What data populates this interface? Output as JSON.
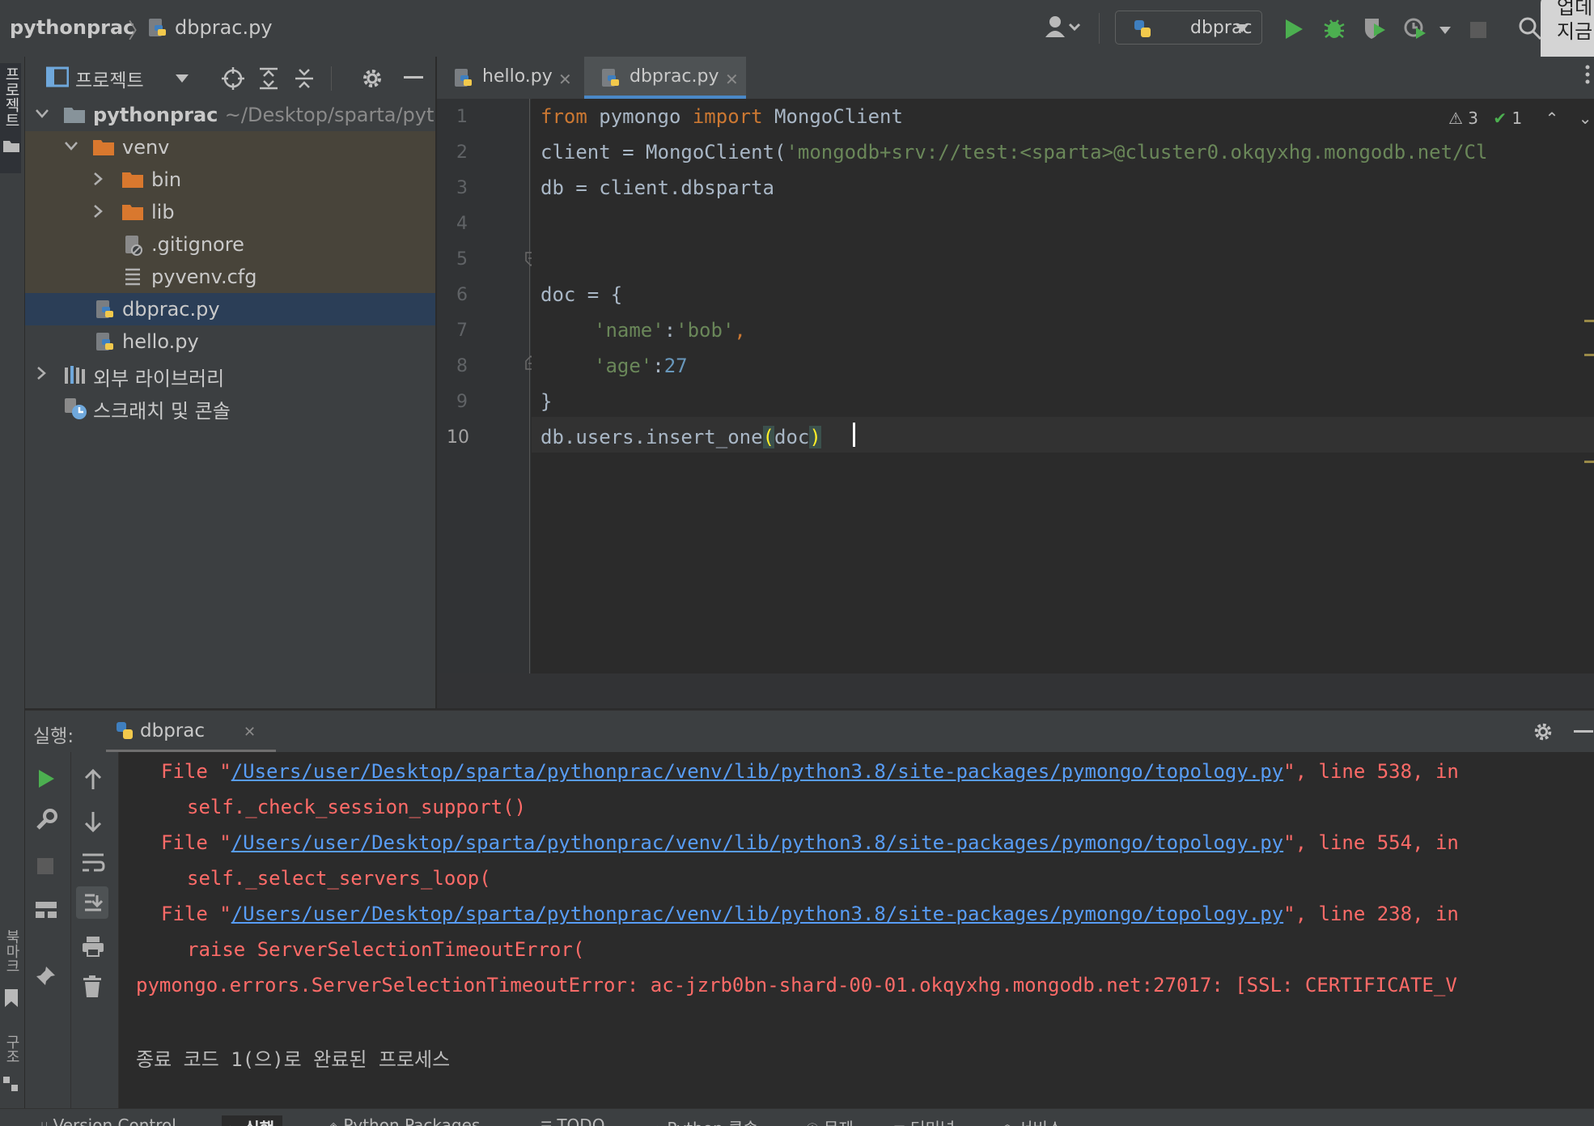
{
  "navbar": {
    "project": "pythonprac",
    "file": "dbprac.py",
    "run_config": "dbprac",
    "notification": [
      "업데",
      "지금"
    ]
  },
  "left_stripe": {
    "project": "프로젝트",
    "bookmarks": "북마크",
    "structure": "구조"
  },
  "project_panel": {
    "title": "프로젝트",
    "tree": {
      "root_name": "pythonprac",
      "root_path": "~/Desktop/sparta/pyth",
      "venv": "venv",
      "bin": "bin",
      "lib": "lib",
      "gitignore": ".gitignore",
      "pyvenv": "pyvenv.cfg",
      "dbprac": "dbprac.py",
      "hello": "hello.py",
      "ext_libs": "외부 라이브러리",
      "scratches": "스크래치 및 콘솔"
    }
  },
  "editor": {
    "tabs": [
      "hello.py",
      "dbprac.py"
    ],
    "active_tab": "dbprac.py",
    "line_numbers": [
      "1",
      "2",
      "3",
      "4",
      "5",
      "6",
      "7",
      "8",
      "9",
      "10"
    ],
    "code": {
      "l1_from": "from",
      "l1_mod": " pymongo ",
      "l1_import": "import",
      "l1_name": " MongoClient",
      "l2_a": "client = MongoClient(",
      "l2_str": "'mongodb+srv://test:<sparta>@cluster0.okqyxhg.mongodb.net/Cl",
      "l3": "db = client.dbsparta",
      "l5": "doc = {",
      "l6_key": "'name'",
      "l6_colon": ":",
      "l6_val": "'bob'",
      "l6_comma": ",",
      "l7_key": "'age'",
      "l7_colon": ":",
      "l7_val": "27",
      "l8": "}",
      "l10_a": "db.users.insert_one",
      "l10_open": "(",
      "l10_arg": "doc",
      "l10_close": ")"
    },
    "inspections": {
      "warnings": "3",
      "ok": "1"
    }
  },
  "run_panel": {
    "label": "실행:",
    "tab": "dbprac",
    "console": {
      "file_prefix": "File \"",
      "path": "/Users/user/Desktop/sparta/pythonprac/venv/lib/python3.8/site-packages/pymongo/topology.py",
      "tail1": "\", line 538, in",
      "code1": "self._check_session_support()",
      "tail2": "\", line 554, in",
      "code2": "self._select_servers_loop(",
      "tail3": "\", line 238, in",
      "code3": "raise ServerSelectionTimeoutError(",
      "error": "pymongo.errors.ServerSelectionTimeoutError: ac-jzrb0bn-shard-00-01.okqyxhg.mongodb.net:27017: [SSL: CERTIFICATE_V",
      "exit": "종료 코드 1(으)로 완료된 프로세스"
    }
  },
  "bottom_bar": {
    "items": [
      "Version Control",
      "실행",
      "Python Packages",
      "TODO",
      "Python 콘솔",
      "문제",
      "터미널",
      "서비스"
    ]
  },
  "colors": {
    "keyword": "#cc7832",
    "string": "#6a8759",
    "number": "#6897bb",
    "error": "#ff6b68",
    "link": "#589df6",
    "run_green": "#4caf50"
  }
}
